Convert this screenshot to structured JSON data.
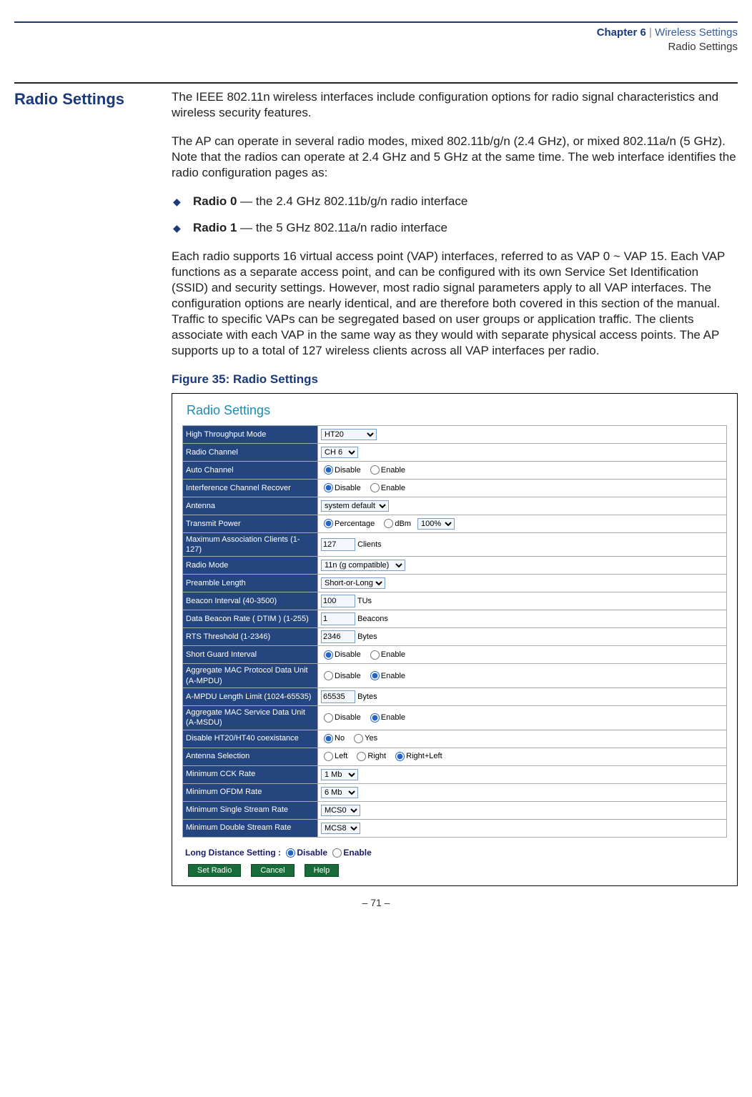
{
  "header": {
    "chapter_prefix": "Chapter 6",
    "separator": " | ",
    "chapter_title": "Wireless Settings",
    "subtitle": "Radio Settings"
  },
  "section": {
    "title": "Radio Settings",
    "para1": "The IEEE 802.11n wireless interfaces include configuration options for radio signal characteristics and wireless security features.",
    "para2": "The AP can operate in several radio modes, mixed 802.11b/g/n (2.4 GHz), or mixed 802.11a/n (5 GHz). Note that the radios can operate at 2.4 GHz and 5 GHz at the same time. The web interface identifies the radio configuration pages as:",
    "bullets": [
      {
        "bold": "Radio 0",
        "rest": " — the 2.4 GHz 802.11b/g/n radio interface"
      },
      {
        "bold": "Radio 1",
        "rest": " — the 5 GHz 802.11a/n radio interface"
      }
    ],
    "para3": "Each radio supports 16 virtual access point (VAP) interfaces, referred to as VAP 0 ~ VAP 15. Each VAP functions as a separate access point, and can be configured with its own Service Set Identification (SSID) and security settings. However, most radio signal parameters apply to all VAP interfaces. The configuration options are nearly identical, and are therefore both covered in this section of the manual. Traffic to specific VAPs can be segregated based on user groups or application traffic. The clients associate with each VAP in the same way as they would with separate physical access points. The AP supports up to a total of 127 wireless clients across all VAP interfaces per radio."
  },
  "figure": {
    "caption": "Figure 35:  Radio Settings",
    "panel_title": "Radio Settings",
    "rows": {
      "ht_mode": {
        "label": "High Throughput Mode",
        "value": "HT20"
      },
      "radio_channel": {
        "label": "Radio Channel",
        "value": "CH 6"
      },
      "auto_channel": {
        "label": "Auto Channel",
        "disable": "Disable",
        "enable": "Enable",
        "selected": "Disable"
      },
      "icr": {
        "label": "Interference Channel Recover",
        "disable": "Disable",
        "enable": "Enable",
        "selected": "Disable"
      },
      "antenna": {
        "label": "Antenna",
        "value": "system default"
      },
      "tx_power": {
        "label": "Transmit Power",
        "opt1": "Percentage",
        "opt2": "dBm",
        "value": "100%",
        "selected": "Percentage"
      },
      "max_assoc": {
        "label": "Maximum Association Clients (1-127)",
        "value": "127",
        "unit": "Clients"
      },
      "radio_mode": {
        "label": "Radio Mode",
        "value": "11n (g compatible)"
      },
      "preamble": {
        "label": "Preamble Length",
        "value": "Short-or-Long"
      },
      "beacon": {
        "label": "Beacon Interval (40-3500)",
        "value": "100",
        "unit": "TUs"
      },
      "dtim": {
        "label": "Data Beacon Rate ( DTIM ) (1-255)",
        "value": "1",
        "unit": "Beacons"
      },
      "rts": {
        "label": "RTS Threshold (1-2346)",
        "value": "2346",
        "unit": "Bytes"
      },
      "sgi": {
        "label": "Short Guard Interval",
        "disable": "Disable",
        "enable": "Enable",
        "selected": "Disable"
      },
      "ampdu": {
        "label": "Aggregate MAC Protocol Data Unit (A-MPDU)",
        "disable": "Disable",
        "enable": "Enable",
        "selected": "Enable"
      },
      "ampdu_len": {
        "label": "A-MPDU Length Limit (1024-65535)",
        "value": "65535",
        "unit": "Bytes"
      },
      "amsdu": {
        "label": "Aggregate MAC Service Data Unit (A-MSDU)",
        "disable": "Disable",
        "enable": "Enable",
        "selected": "Enable"
      },
      "ht_coex": {
        "label": "Disable HT20/HT40 coexistance",
        "opt1": "No",
        "opt2": "Yes",
        "selected": "No"
      },
      "ant_sel": {
        "label": "Antenna Selection",
        "opt1": "Left",
        "opt2": "Right",
        "opt3": "Right+Left",
        "selected": "Right+Left"
      },
      "min_cck": {
        "label": "Minimum CCK Rate",
        "value": "1 Mb"
      },
      "min_ofdm": {
        "label": "Minimum OFDM Rate",
        "value": "6 Mb"
      },
      "min_ss": {
        "label": "Minimum Single Stream Rate",
        "value": "MCS0"
      },
      "min_ds": {
        "label": "Minimum Double Stream Rate",
        "value": "MCS8"
      }
    },
    "long_distance": {
      "label": "Long Distance Setting :",
      "disable": "Disable",
      "enable": "Enable",
      "selected": "Disable"
    },
    "buttons": {
      "set": "Set Radio",
      "cancel": "Cancel",
      "help": "Help"
    }
  },
  "footer": {
    "page": "–  71  –"
  }
}
